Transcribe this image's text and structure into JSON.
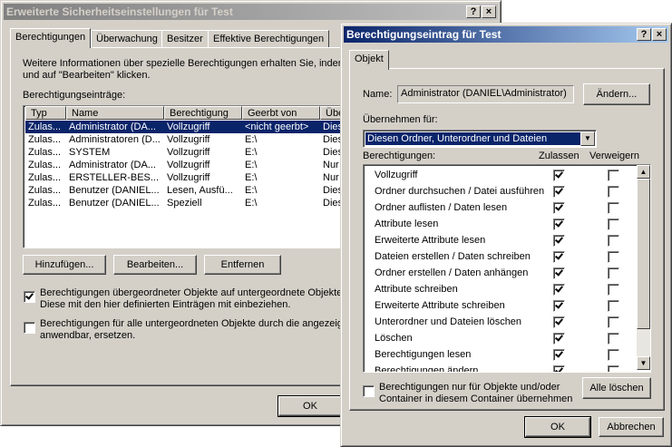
{
  "back_window": {
    "title": "Erweiterte Sicherheitseinstellungen für Test",
    "title_buttons": [
      "?",
      "×"
    ],
    "tabs": [
      "Berechtigungen",
      "Überwachung",
      "Besitzer",
      "Effektive Berechtigungen"
    ],
    "info_line1": "Weitere Informationen über spezielle Berechtigungen erhalten Sie, indem S",
    "info_line2": "und auf \"Bearbeiten\" klicken.",
    "entries_label": "Berechtigungseinträge:",
    "columns": [
      "Typ",
      "Name",
      "Berechtigung",
      "Geerbt von",
      "Übe"
    ],
    "rows": [
      [
        "Zulas...",
        "Administrator (DA...",
        "Vollzugriff",
        "<nicht geerbt>",
        "Dies"
      ],
      [
        "Zulas...",
        "Administratoren (D...",
        "Vollzugriff",
        "E:\\",
        "Dies"
      ],
      [
        "Zulas...",
        "SYSTEM",
        "Vollzugriff",
        "E:\\",
        "Dies"
      ],
      [
        "Zulas...",
        "Administrator (DA...",
        "Vollzugriff",
        "E:\\",
        "Nur"
      ],
      [
        "Zulas...",
        "ERSTELLER-BES...",
        "Vollzugriff",
        "E:\\",
        "Nur"
      ],
      [
        "Zulas...",
        "Benutzer (DANIEL...",
        "Lesen, Ausfü...",
        "E:\\",
        "Dies"
      ],
      [
        "Zulas...",
        "Benutzer (DANIEL...",
        "Speziell",
        "E:\\",
        "Dies"
      ]
    ],
    "btn_add": "Hinzufügen...",
    "btn_edit": "Bearbeiten...",
    "btn_remove": "Entfernen",
    "inherit_line1": "Berechtigungen übergeordneter Objekte auf untergeordnete Objekte, s",
    "inherit_line2": "Diese mit den hier definierten Einträgen mit einbeziehen.",
    "replace_line1": "Berechtigungen für alle untergeordneten Objekte durch die angezeigt",
    "replace_line2": "anwendbar, ersetzen.",
    "btn_ok": "OK"
  },
  "front_window": {
    "title": "Berechtigungseintrag für Test",
    "title_buttons": [
      "?",
      "×"
    ],
    "tab": "Objekt",
    "name_label": "Name:",
    "name_value": "Administrator (DANIEL\\Administrator)",
    "btn_change": "Ändern...",
    "apply_label": "Übernehmen für:",
    "apply_value": "Diesen Ordner, Unterordner und Dateien",
    "perms_label": "Berechtigungen:",
    "col_allow": "Zulassen",
    "col_deny": "Verweigern",
    "permissions": [
      {
        "name": "Vollzugriff",
        "allow": true,
        "deny": false
      },
      {
        "name": "Ordner durchsuchen / Datei ausführen",
        "allow": true,
        "deny": false
      },
      {
        "name": "Ordner auflisten / Daten lesen",
        "allow": true,
        "deny": false
      },
      {
        "name": "Attribute lesen",
        "allow": true,
        "deny": false
      },
      {
        "name": "Erweiterte Attribute lesen",
        "allow": true,
        "deny": false
      },
      {
        "name": "Dateien erstellen / Daten schreiben",
        "allow": true,
        "deny": false
      },
      {
        "name": "Ordner erstellen / Daten anhängen",
        "allow": true,
        "deny": false
      },
      {
        "name": "Attribute schreiben",
        "allow": true,
        "deny": false
      },
      {
        "name": "Erweiterte Attribute schreiben",
        "allow": true,
        "deny": false
      },
      {
        "name": "Unterordner und Dateien löschen",
        "allow": true,
        "deny": false
      },
      {
        "name": "Löschen",
        "allow": true,
        "deny": false
      },
      {
        "name": "Berechtigungen lesen",
        "allow": true,
        "deny": false
      },
      {
        "name": "Berechtigungen ändern",
        "allow": true,
        "deny": false
      }
    ],
    "only_line1": "Berechtigungen nur für Objekte und/oder",
    "only_line2": "Container in diesem Container übernehmen",
    "btn_clear": "Alle löschen",
    "btn_ok": "OK",
    "btn_cancel": "Abbrechen"
  }
}
